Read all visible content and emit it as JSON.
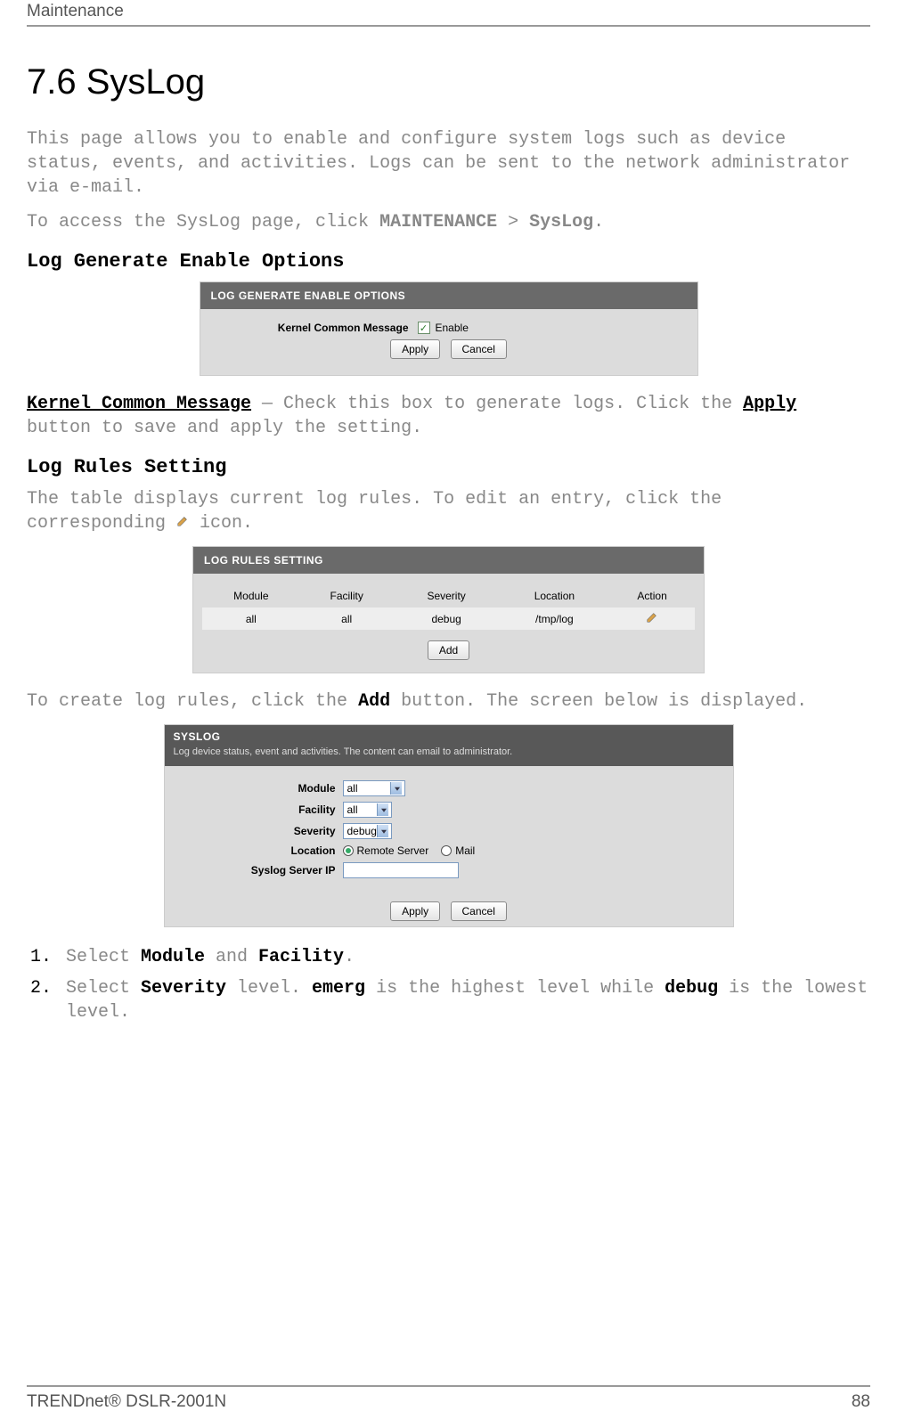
{
  "header": {
    "section": "Maintenance"
  },
  "title": {
    "number": "7.6",
    "name": "SysLog",
    "combined": "7.6   SysLog"
  },
  "intro": {
    "p1": "This page allows you to enable and configure system logs such as device status, events, and activities. Logs can be sent to the network administrator via e-mail.",
    "p2_prefix": "To access the SysLog page, click ",
    "p2_b1": "MAINTENANCE",
    "p2_mid": " > ",
    "p2_b2": "SysLog",
    "p2_suffix": "."
  },
  "section1": {
    "heading": "Log Generate Enable Options",
    "panel_title": "LOG GENERATE ENABLE OPTIONS",
    "row_label": "Kernel Common Message",
    "checkbox_checked": true,
    "checkbox_label": "Enable",
    "apply": "Apply",
    "cancel": "Cancel",
    "desc_b1": "Kernel Common Message",
    "desc_mid": " — Check this box to generate logs. Click the ",
    "desc_b2": "Apply",
    "desc_suffix": " button to save and apply the setting."
  },
  "section2": {
    "heading": "Log Rules Setting",
    "intro_pre": "The table displays current log rules. To edit an entry, click the corresponding ",
    "intro_post": " icon.",
    "panel_title": "LOG RULES SETTING",
    "columns": [
      "Module",
      "Facility",
      "Severity",
      "Location",
      "Action"
    ],
    "row": {
      "module": "all",
      "facility": "all",
      "severity": "debug",
      "location": "/tmp/log"
    },
    "add": "Add",
    "after_pre": "To create log rules, click the ",
    "after_b": "Add",
    "after_post": " button. The screen below is displayed."
  },
  "syslog": {
    "title": "SYSLOG",
    "desc": "Log device status, event and activities. The content can email to administrator.",
    "module_label": "Module",
    "module_value": "all",
    "facility_label": "Facility",
    "facility_value": "all",
    "severity_label": "Severity",
    "severity_value": "debug",
    "location_label": "Location",
    "loc_opt1": "Remote Server",
    "loc_opt2": "Mail",
    "server_label": "Syslog Server IP",
    "server_value": "",
    "apply": "Apply",
    "cancel": "Cancel"
  },
  "steps": {
    "s1_pre": "Select ",
    "s1_b1": "Module",
    "s1_mid": " and ",
    "s1_b2": "Facility",
    "s1_post": ".",
    "s2_pre": "Select ",
    "s2_b1": "Severity",
    "s2_mid1": " level. ",
    "s2_b2": "emerg",
    "s2_mid2": " is the highest level while ",
    "s2_b3": "debug",
    "s2_post": " is the lowest level."
  },
  "footer": {
    "left": "TRENDnet® DSLR-2001N",
    "right": "88"
  }
}
